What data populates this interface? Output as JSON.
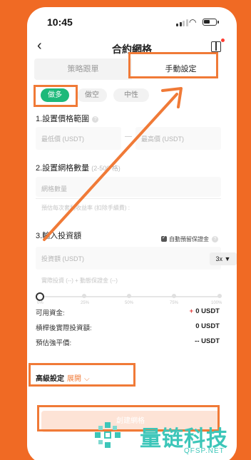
{
  "status_bar": {
    "time": "10:45"
  },
  "nav": {
    "title": "合約網格"
  },
  "tabs": [
    {
      "label": "策略跟單"
    },
    {
      "label": "手動設定"
    }
  ],
  "direction": [
    "做多",
    "做空",
    "中性"
  ],
  "section1": {
    "title": "1.設置價格範圍",
    "low_placeholder": "最低價 (USDT)",
    "dash": "—",
    "high_placeholder": "最高價 (USDT)"
  },
  "section2": {
    "title": "2.設置網格數量",
    "hint": "(2-500 格)",
    "placeholder": "網格數量",
    "yield": "預估每次套利收益率 (扣除手續費) :"
  },
  "section3": {
    "title": "3.輸入投資額",
    "auto_margin": "自動預留保證金",
    "placeholder": "投資額 (USDT)",
    "leverage": "3x ▼",
    "detail": "實際投資 (--) + 動態保證金 (--)"
  },
  "slider": {
    "value_pct": 0,
    "ticks": [
      "0%",
      "25%",
      "50%",
      "75%",
      "100%"
    ]
  },
  "summary": [
    {
      "label": "可用資金:",
      "value": "0 USDT"
    },
    {
      "label": "槓桿後實際投資額:",
      "value": "0 USDT"
    },
    {
      "label": "預估強平價:",
      "value": "-- USDT"
    }
  ],
  "advanced": {
    "label": "高級設定",
    "expand": "展開"
  },
  "create_button": "創建網格",
  "watermark": {
    "brand": "量链科技",
    "url": "QFSP.NET"
  },
  "colors": {
    "background": "#f06a24",
    "long": "#1db97a",
    "highlight": "#f07a37",
    "brand": "#3cc6b9"
  }
}
